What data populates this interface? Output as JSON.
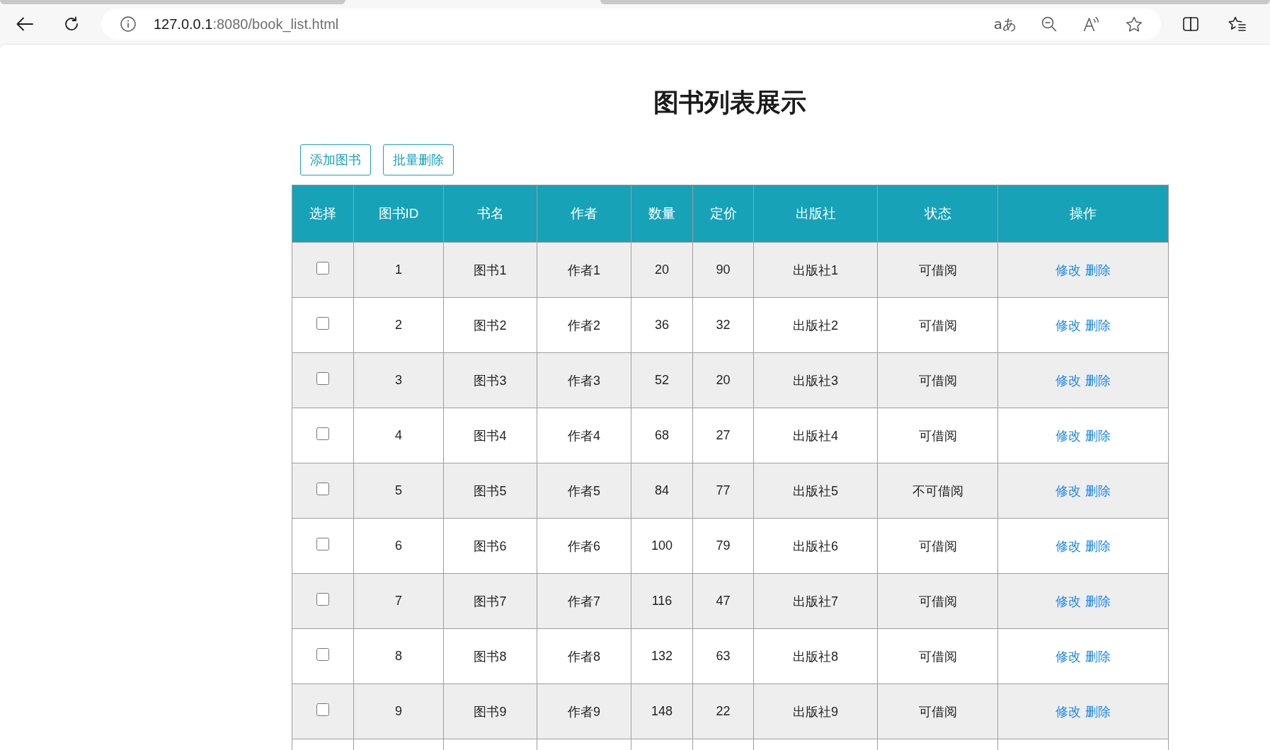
{
  "browser": {
    "url": {
      "host": "127.0.0.1",
      "rest": ":8080/book_list.html"
    },
    "translate_glyph": "aあ"
  },
  "page": {
    "title": "图书列表展示",
    "buttons": [
      "添加图书",
      "批量删除"
    ]
  },
  "table": {
    "columns": [
      "选择",
      "图书ID",
      "书名",
      "作者",
      "数量",
      "定价",
      "出版社",
      "状态",
      "操作"
    ],
    "rows": [
      {
        "checked": false,
        "id": "1",
        "name": "图书1",
        "author": "作者1",
        "quantity": "20",
        "price": "90",
        "publisher": "出版社1",
        "status": "可借阅",
        "actions": [
          "修改",
          "删除"
        ]
      },
      {
        "checked": false,
        "id": "2",
        "name": "图书2",
        "author": "作者2",
        "quantity": "36",
        "price": "32",
        "publisher": "出版社2",
        "status": "可借阅",
        "actions": [
          "修改",
          "删除"
        ]
      },
      {
        "checked": false,
        "id": "3",
        "name": "图书3",
        "author": "作者3",
        "quantity": "52",
        "price": "20",
        "publisher": "出版社3",
        "status": "可借阅",
        "actions": [
          "修改",
          "删除"
        ]
      },
      {
        "checked": false,
        "id": "4",
        "name": "图书4",
        "author": "作者4",
        "quantity": "68",
        "price": "27",
        "publisher": "出版社4",
        "status": "可借阅",
        "actions": [
          "修改",
          "删除"
        ]
      },
      {
        "checked": false,
        "id": "5",
        "name": "图书5",
        "author": "作者5",
        "quantity": "84",
        "price": "77",
        "publisher": "出版社5",
        "status": "不可借阅",
        "actions": [
          "修改",
          "删除"
        ]
      },
      {
        "checked": false,
        "id": "6",
        "name": "图书6",
        "author": "作者6",
        "quantity": "100",
        "price": "79",
        "publisher": "出版社6",
        "status": "可借阅",
        "actions": [
          "修改",
          "删除"
        ]
      },
      {
        "checked": false,
        "id": "7",
        "name": "图书7",
        "author": "作者7",
        "quantity": "116",
        "price": "47",
        "publisher": "出版社7",
        "status": "可借阅",
        "actions": [
          "修改",
          "删除"
        ]
      },
      {
        "checked": false,
        "id": "8",
        "name": "图书8",
        "author": "作者8",
        "quantity": "132",
        "price": "63",
        "publisher": "出版社8",
        "status": "可借阅",
        "actions": [
          "修改",
          "删除"
        ]
      },
      {
        "checked": false,
        "id": "9",
        "name": "图书9",
        "author": "作者9",
        "quantity": "148",
        "price": "22",
        "publisher": "出版社9",
        "status": "可借阅",
        "actions": [
          "修改",
          "删除"
        ]
      }
    ]
  }
}
